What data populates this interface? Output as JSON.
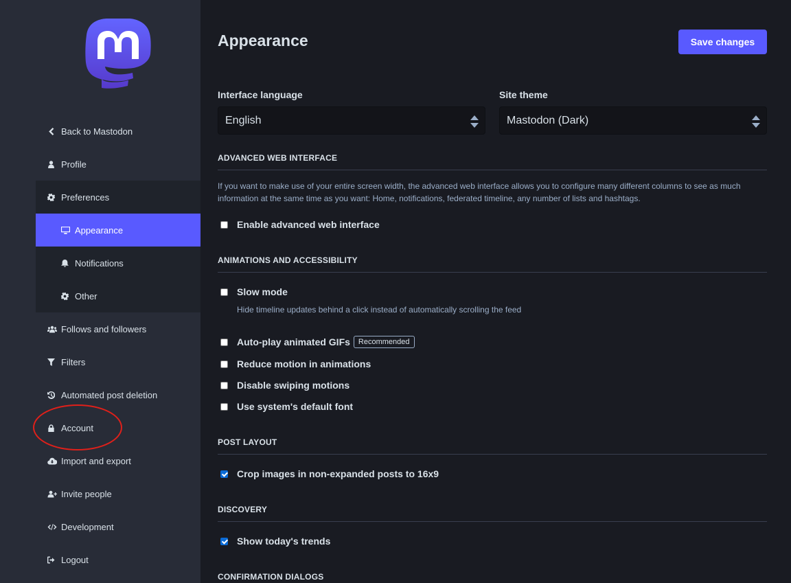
{
  "sidebar": {
    "logo_icon": "mastodon-logo",
    "items": [
      {
        "label": "Back to Mastodon",
        "icon": "chevron-left-icon"
      },
      {
        "label": "Profile",
        "icon": "user-icon"
      },
      {
        "label": "Preferences",
        "icon": "gear-icon"
      },
      {
        "label": "Appearance",
        "icon": "desktop-icon"
      },
      {
        "label": "Notifications",
        "icon": "bell-icon"
      },
      {
        "label": "Other",
        "icon": "gear-icon"
      },
      {
        "label": "Follows and followers",
        "icon": "users-icon"
      },
      {
        "label": "Filters",
        "icon": "filter-icon"
      },
      {
        "label": "Automated post deletion",
        "icon": "history-icon"
      },
      {
        "label": "Account",
        "icon": "lock-icon"
      },
      {
        "label": "Import and export",
        "icon": "cloud-download-icon"
      },
      {
        "label": "Invite people",
        "icon": "user-plus-icon"
      },
      {
        "label": "Development",
        "icon": "code-icon"
      },
      {
        "label": "Logout",
        "icon": "sign-out-icon"
      }
    ],
    "active_item": "Appearance"
  },
  "main": {
    "title": "Appearance",
    "save_label": "Save changes",
    "interface_language": {
      "label": "Interface language",
      "value": "English"
    },
    "site_theme": {
      "label": "Site theme",
      "value": "Mastodon (Dark)"
    },
    "advanced": {
      "title": "ADVANCED WEB INTERFACE",
      "hint": "If you want to make use of your entire screen width, the advanced web interface allows you to configure many different columns to see as much information at the same time as you want: Home, notifications, federated timeline, any number of lists and hashtags.",
      "enable_label": "Enable advanced web interface",
      "enable_checked": false
    },
    "animations": {
      "title": "ANIMATIONS AND ACCESSIBILITY",
      "slow_mode_label": "Slow mode",
      "slow_mode_hint": "Hide timeline updates behind a click instead of automatically scrolling the feed",
      "autoplay_label": "Auto-play animated GIFs",
      "autoplay_badge": "Recommended",
      "reduce_motion_label": "Reduce motion in animations",
      "disable_swipe_label": "Disable swiping motions",
      "system_font_label": "Use system's default font"
    },
    "post_layout": {
      "title": "POST LAYOUT",
      "crop_label": "Crop images in non-expanded posts to 16x9",
      "crop_checked": true
    },
    "discovery": {
      "title": "DISCOVERY",
      "trends_label": "Show today's trends",
      "trends_checked": true
    },
    "confirmation": {
      "title": "CONFIRMATION DIALOGS"
    }
  },
  "colors": {
    "accent": "#595aff",
    "sidebar_bg": "#282c37",
    "main_bg": "#191b22",
    "annotation": "#e0201a"
  }
}
